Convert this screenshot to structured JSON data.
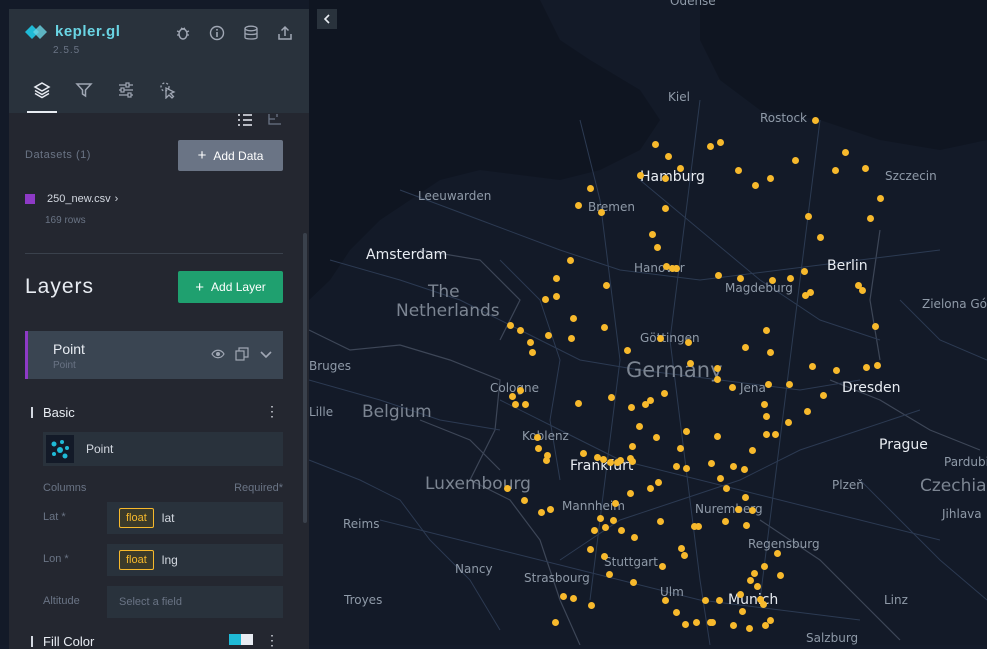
{
  "app": {
    "name": "kepler.gl",
    "version": "2.5.5"
  },
  "header_icons": [
    "bug-icon",
    "info-icon",
    "database-icon",
    "share-icon"
  ],
  "tabs": [
    {
      "icon": "layers-icon",
      "active": true
    },
    {
      "icon": "filter-icon",
      "active": false
    },
    {
      "icon": "sliders-icon",
      "active": false
    },
    {
      "icon": "pointer-icon",
      "active": false
    }
  ],
  "datasets": {
    "title": "Datasets (1)",
    "add_button": "Add Data",
    "items": [
      {
        "name": "250_new.csv",
        "rows": "169 rows",
        "color": "#8e3ac6"
      }
    ]
  },
  "layers": {
    "title": "Layers",
    "add_button": "Add Layer",
    "items": [
      {
        "name": "Point",
        "type": "Point",
        "color": "#8e3ac6"
      }
    ]
  },
  "layer_config": {
    "basic_label": "Basic",
    "layer_type": "Point",
    "columns_label": "Columns",
    "required_label": "Required*",
    "fields": [
      {
        "label": "Lat *",
        "type": "float",
        "value": "lat"
      },
      {
        "label": "Lon *",
        "type": "float",
        "value": "lng"
      }
    ],
    "altitude": {
      "label": "Altitude",
      "placeholder": "Select a field"
    },
    "fill_color_label": "Fill Color"
  },
  "map": {
    "point_color": "#f7b92c",
    "labels": [
      {
        "text": "Odense",
        "cls": "small"
      },
      {
        "text": "Kiel",
        "cls": "small"
      },
      {
        "text": "Rostock",
        "cls": "small"
      },
      {
        "text": "Hamburg",
        "cls": "mid"
      },
      {
        "text": "Szczecin",
        "cls": "small"
      },
      {
        "text": "Leeuwarden",
        "cls": "small"
      },
      {
        "text": "Bremen",
        "cls": "small"
      },
      {
        "text": "Amsterdam",
        "cls": "mid"
      },
      {
        "text": "Hanover",
        "cls": "small"
      },
      {
        "text": "Berlin",
        "cls": "mid"
      },
      {
        "text": "The",
        "cls": "country"
      },
      {
        "text": "Netherlands",
        "cls": "country"
      },
      {
        "text": "Magdeburg",
        "cls": "small"
      },
      {
        "text": "Zielona Gór",
        "cls": "small"
      },
      {
        "text": "Göttingen",
        "cls": "small"
      },
      {
        "text": "Germany",
        "cls": "bigcountry"
      },
      {
        "text": "Bruges",
        "cls": "small"
      },
      {
        "text": "Cologne",
        "cls": "small"
      },
      {
        "text": "Jena",
        "cls": "small"
      },
      {
        "text": "Dresden",
        "cls": "mid"
      },
      {
        "text": "Lille",
        "cls": "small"
      },
      {
        "text": "Belgium",
        "cls": "country"
      },
      {
        "text": "Koblenz",
        "cls": "small"
      },
      {
        "text": "Prague",
        "cls": "mid"
      },
      {
        "text": "Frankfurt",
        "cls": "mid"
      },
      {
        "text": "Pardubi",
        "cls": "small"
      },
      {
        "text": "Luxembourg",
        "cls": "country"
      },
      {
        "text": "Plzeň",
        "cls": "small"
      },
      {
        "text": "Czechia",
        "cls": "country"
      },
      {
        "text": "Reims",
        "cls": "small"
      },
      {
        "text": "Mannheim",
        "cls": "small"
      },
      {
        "text": "Nuremberg",
        "cls": "small"
      },
      {
        "text": "Jihlava",
        "cls": "small"
      },
      {
        "text": "Regensburg",
        "cls": "small"
      },
      {
        "text": "Nancy",
        "cls": "small"
      },
      {
        "text": "Stuttgart",
        "cls": "small"
      },
      {
        "text": "Strasbourg",
        "cls": "small"
      },
      {
        "text": "Troyes",
        "cls": "small"
      },
      {
        "text": "Ulm",
        "cls": "small"
      },
      {
        "text": "Munich",
        "cls": "mid"
      },
      {
        "text": "Linz",
        "cls": "small"
      },
      {
        "text": "Salzburg",
        "cls": "small"
      }
    ]
  }
}
